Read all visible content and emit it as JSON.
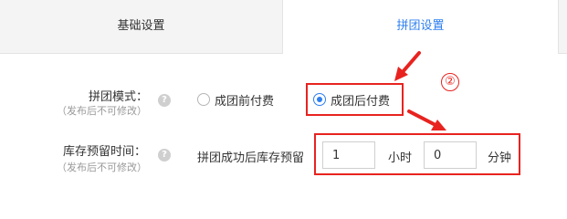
{
  "tabs": [
    {
      "label": "基础设置",
      "active": false
    },
    {
      "label": "拼团设置",
      "active": true
    }
  ],
  "form": {
    "mode": {
      "label": "拼团模式：",
      "hint": "（发布后不可修改）",
      "options": [
        {
          "label": "成团前付费",
          "checked": false
        },
        {
          "label": "成团后付费",
          "checked": true
        }
      ]
    },
    "reserve": {
      "label": "库存预留时间：",
      "hint": "（发布后不可修改）",
      "prefix": "拼团成功后库存预留",
      "hours_value": "1",
      "hours_unit": "小时",
      "minutes_value": "0",
      "minutes_unit": "分钟"
    }
  },
  "annotation": {
    "number": "②"
  },
  "colors": {
    "accent": "#2d7ff0",
    "annotation_red": "#e8231f"
  }
}
